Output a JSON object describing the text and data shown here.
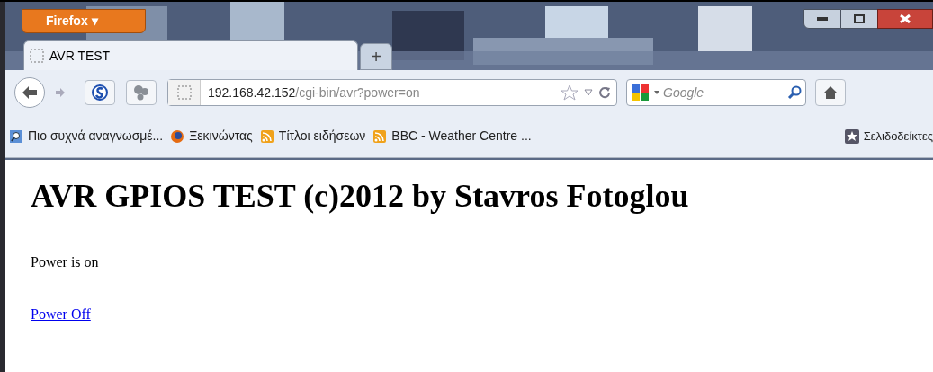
{
  "window": {
    "app_button": "Firefox ▾"
  },
  "tabs": [
    {
      "title": "AVR TEST",
      "selected": true
    },
    {
      "title": "+",
      "kind": "new"
    }
  ],
  "address_bar": {
    "host": "192.168.42.152",
    "path": "/cgi-bin/avr?power=on"
  },
  "search": {
    "placeholder": "Google"
  },
  "bookmarks": [
    {
      "label": "Πιο συχνά αναγνωσμέ...",
      "kind": "search"
    },
    {
      "label": "Ξεκινώντας",
      "kind": "firefox"
    },
    {
      "label": "Τίτλοι ειδήσεων",
      "kind": "feed"
    },
    {
      "label": "BBC - Weather Centre ...",
      "kind": "feed"
    }
  ],
  "bookmarks_menu": "Σελιδοδείκτες",
  "page": {
    "heading": "AVR GPIOS TEST (c)2012 by Stavros Fotoglou",
    "status": "Power is on",
    "link": "Power Off"
  }
}
